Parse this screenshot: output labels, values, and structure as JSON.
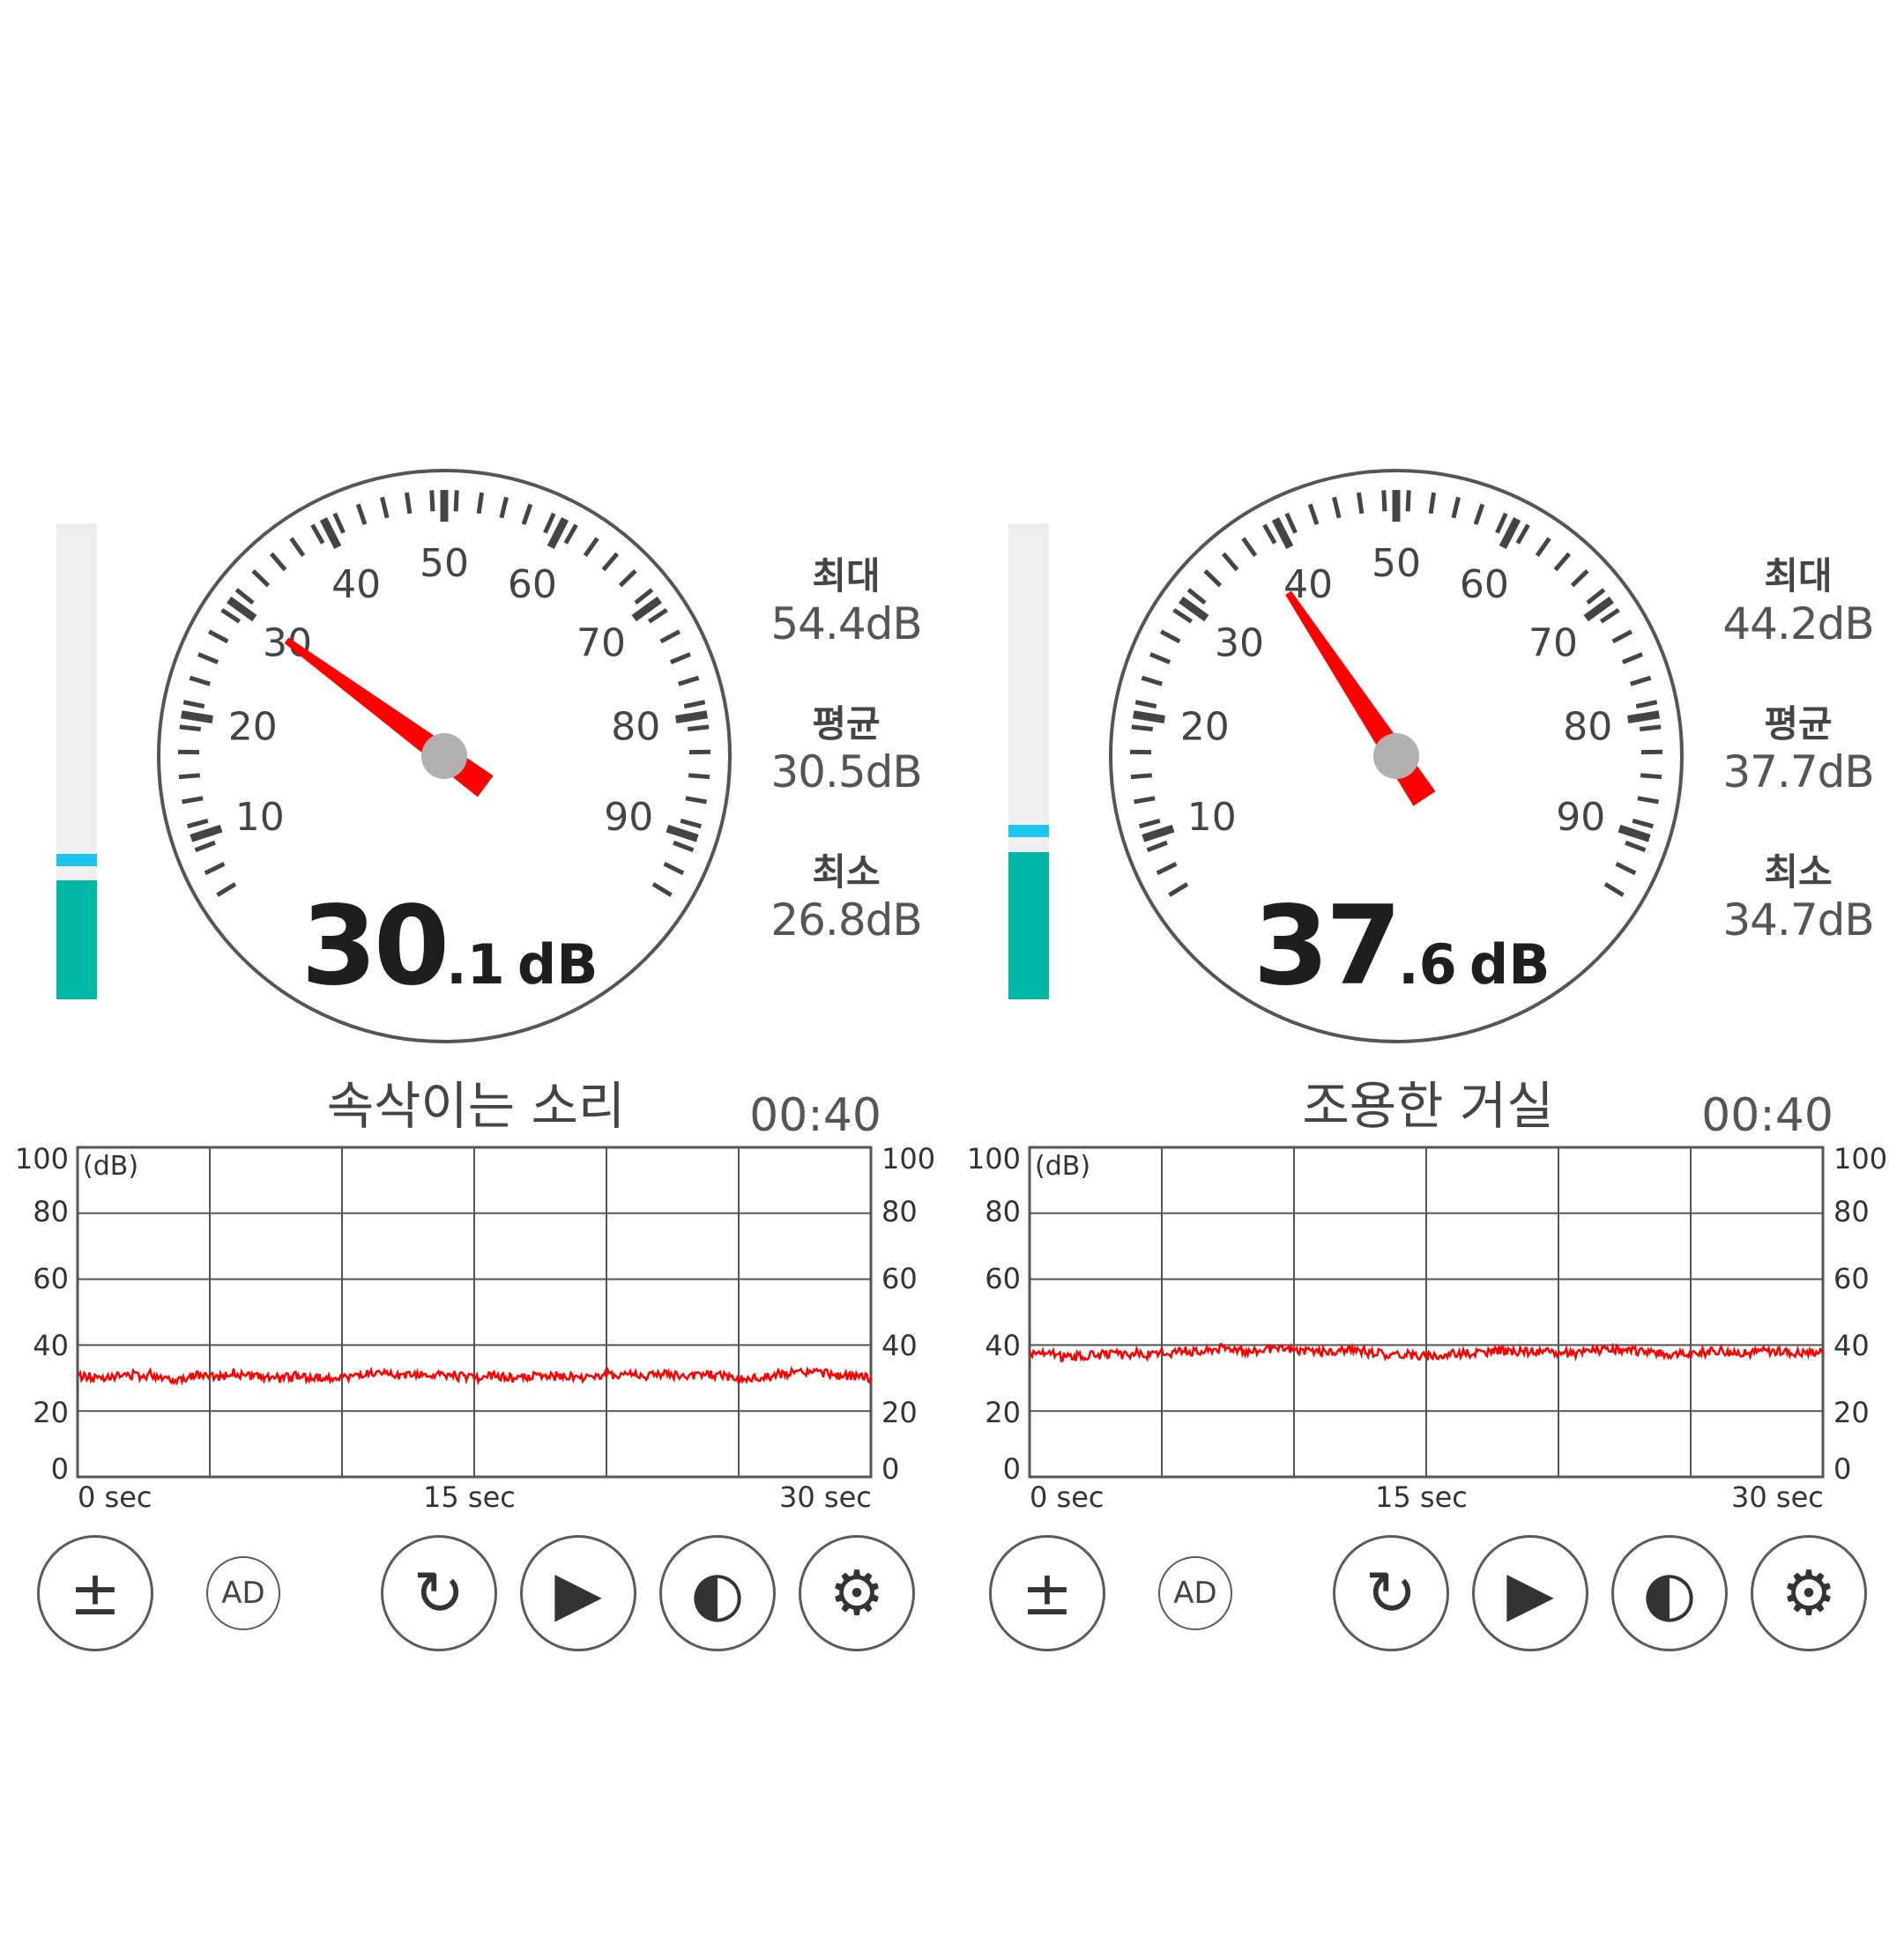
{
  "meters": [
    {
      "title": "속삭이는 소리",
      "timer": "00:40",
      "reading_int": "30",
      "reading_dec": ".1",
      "unit": "dB",
      "value_db": 30.1,
      "level_fraction": 0.25,
      "peak_fraction": 0.28,
      "stats": {
        "max_label": "최대",
        "max_value": "54.4dB",
        "avg_label": "평균",
        "avg_value": "30.5dB",
        "min_label": "최소",
        "min_value": "26.8dB"
      },
      "chart_data": {
        "type": "line",
        "ylabel": "(dB)",
        "ylim": [
          0,
          100
        ],
        "xlim": [
          0,
          36
        ],
        "y_ticks": [
          "100",
          "80",
          "60",
          "40",
          "20",
          "0"
        ],
        "x_ticks": [
          "0 sec",
          "15 sec",
          "30 sec"
        ],
        "series": [
          {
            "mean": 30.5,
            "min": 26.8,
            "max": 34.0
          }
        ]
      }
    },
    {
      "title": "조용한 거실",
      "timer": "00:40",
      "reading_int": "37",
      "reading_dec": ".6",
      "unit": "dB",
      "value_db": 37.6,
      "level_fraction": 0.31,
      "peak_fraction": 0.34,
      "stats": {
        "max_label": "최대",
        "max_value": "44.2dB",
        "avg_label": "평균",
        "avg_value": "37.7dB",
        "min_label": "최소",
        "min_value": "34.7dB"
      },
      "chart_data": {
        "type": "line",
        "ylabel": "(dB)",
        "ylim": [
          0,
          100
        ],
        "xlim": [
          0,
          36
        ],
        "y_ticks": [
          "100",
          "80",
          "60",
          "40",
          "20",
          "0"
        ],
        "x_ticks": [
          "0 sec",
          "15 sec",
          "30 sec"
        ],
        "series": [
          {
            "mean": 37.7,
            "min": 34.7,
            "max": 40.5
          }
        ]
      }
    }
  ],
  "dial": {
    "min": 0,
    "max": 100,
    "labels": [
      "10",
      "20",
      "30",
      "40",
      "50",
      "60",
      "70",
      "80",
      "90"
    ]
  },
  "buttons": {
    "calibrate_glyph": "±",
    "ad_label": "AD",
    "reset_glyph": "↻",
    "play_glyph": "▶",
    "theme_glyph": "◐",
    "settings_glyph": "⚙"
  },
  "colors": {
    "needle": "#ff0000",
    "level": "#00b8a6",
    "peak": "#1ec6ee",
    "trace": "#ff0000",
    "hub": "#b0b0b0"
  }
}
